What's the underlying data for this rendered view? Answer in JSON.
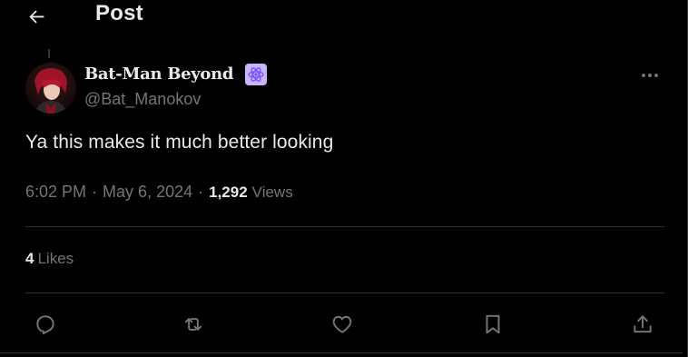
{
  "header": {
    "title": "Post",
    "back_icon": "arrow-left-icon"
  },
  "post": {
    "author_name": "Bat-Man Beyond",
    "author_handle": "@Bat_Manokov",
    "badge_icon": "atom-icon",
    "text": "Ya this makes it much better looking",
    "time": "6:02 PM",
    "separator": "·",
    "date": "May 6, 2024",
    "views_count": "1,292",
    "views_label": "Views",
    "likes_count": "4",
    "likes_label": "Likes"
  },
  "actions": [
    {
      "name": "reply",
      "icon": "reply-bubble-icon"
    },
    {
      "name": "repost",
      "icon": "repost-arrows-icon"
    },
    {
      "name": "like",
      "icon": "heart-icon"
    },
    {
      "name": "bookmark",
      "icon": "bookmark-icon"
    },
    {
      "name": "share",
      "icon": "share-upload-icon"
    }
  ],
  "colors": {
    "background": "#000000",
    "primary_text": "#e7e9ea",
    "secondary_text": "#71767b",
    "divider": "#2f3336",
    "badge": "#c8b4ff",
    "badge_icon": "#7856ff"
  }
}
